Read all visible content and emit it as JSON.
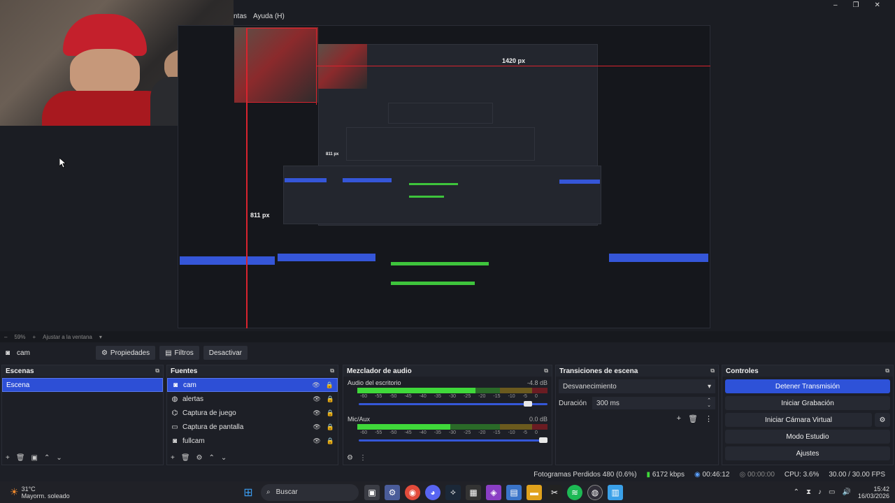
{
  "window": {
    "menu_partial": "ntas",
    "menu_help": "Ayuda (H)",
    "controls": [
      "–",
      "❐",
      "✕"
    ]
  },
  "preview": {
    "width_label": "1420 px",
    "height_label": "811 px",
    "nested_height_label": "811 px",
    "zoom": "59%",
    "fit": "Ajustar a la ventana"
  },
  "source_toolbar": {
    "source_name": "cam",
    "properties": "Propiedades",
    "filters": "Filtros",
    "deactivate": "Desactivar"
  },
  "scenes": {
    "title": "Escenas",
    "items": [
      "Escena"
    ]
  },
  "sources": {
    "title": "Fuentes",
    "items": [
      {
        "label": "cam",
        "icon": "camera-icon"
      },
      {
        "label": "alertas",
        "icon": "globe-icon"
      },
      {
        "label": "Captura de juego",
        "icon": "gamepad-icon"
      },
      {
        "label": "Captura de pantalla",
        "icon": "monitor-icon"
      },
      {
        "label": "fullcam",
        "icon": "camera-icon"
      }
    ]
  },
  "mixer": {
    "title": "Mezclador de audio",
    "channels": [
      {
        "name": "Audio del escritorio",
        "db": "-4.8 dB",
        "level": 0.62,
        "volume": 0.92
      },
      {
        "name": "Mic/Aux",
        "db": "0.0 dB",
        "level": 0.49,
        "volume": 1.0
      }
    ],
    "ticks": [
      "-60",
      "-55",
      "-50",
      "-45",
      "-40",
      "-35",
      "-30",
      "-25",
      "-20",
      "-15",
      "-10",
      "-5",
      "0"
    ]
  },
  "transitions": {
    "title": "Transiciones de escena",
    "selected": "Desvanecimiento",
    "duration_label": "Duración",
    "duration_value": "300 ms"
  },
  "controls": {
    "title": "Controles",
    "stop_stream": "Detener Transmisión",
    "start_recording": "Iniciar Grabación",
    "virtual_cam": "Iniciar Cámara Virtual",
    "studio_mode": "Modo Estudio",
    "settings": "Ajustes"
  },
  "status": {
    "dropped_frames": "Fotogramas Perdidos 480 (0.6%)",
    "bitrate": "6172 kbps",
    "stream_time": "00:46:12",
    "rec_time": "00:00:00",
    "cpu": "CPU: 3.6%",
    "fps": "30.00 / 30.00 FPS"
  },
  "taskbar": {
    "weather_temp": "31°C",
    "weather_desc": "Mayorm. soleado",
    "search": "Buscar",
    "time": "15:42",
    "date": "16/03/2026"
  },
  "colors": {
    "accent": "#2e52d8",
    "guide_red": "#d9232e",
    "meter_green": "#3fd83a"
  }
}
